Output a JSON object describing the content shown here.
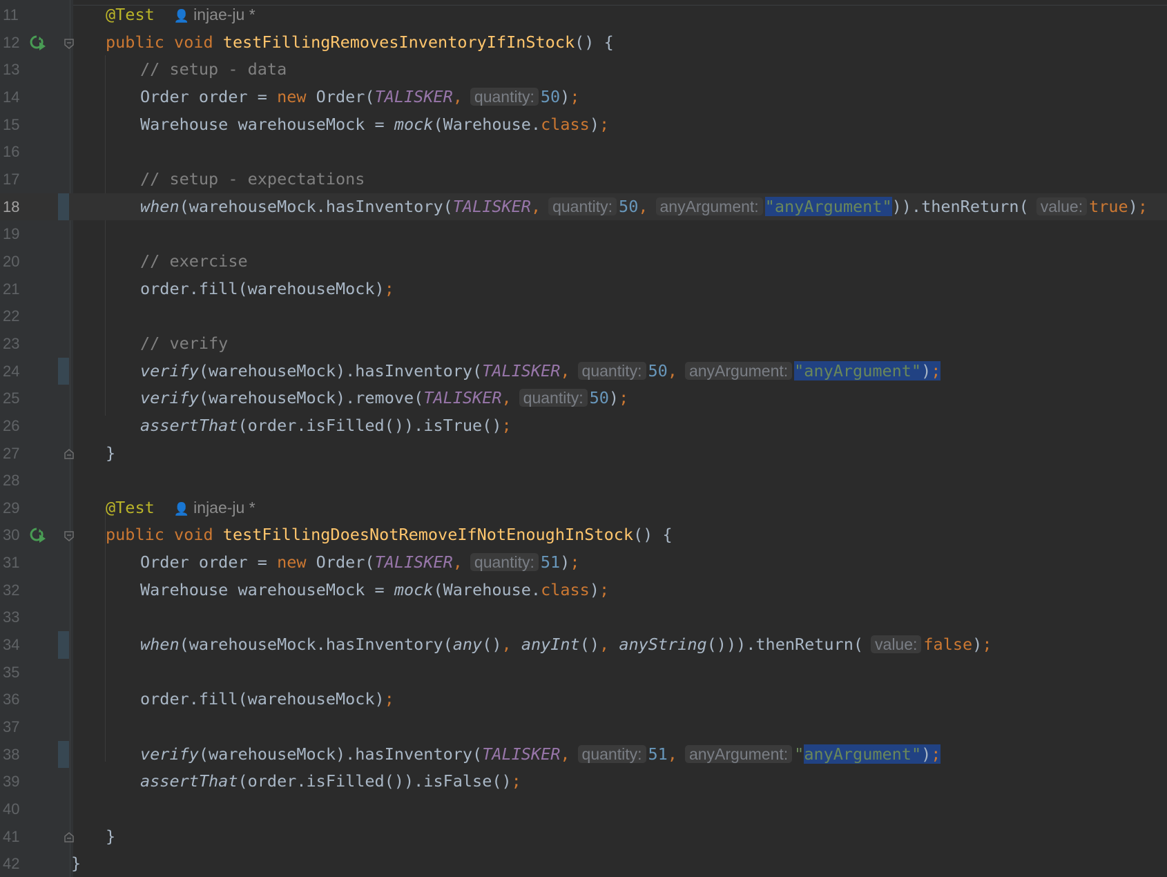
{
  "editor": {
    "lines": {
      "l11": {
        "num": "11",
        "annotation": "@Test",
        "author": "injae-ju *"
      },
      "l12": {
        "num": "12",
        "kw1": "public",
        "kw2": "void",
        "method": "testFillingRemovesInventoryIfInStock",
        "rest": "() {"
      },
      "l13": {
        "num": "13",
        "comment": "// setup - data"
      },
      "l14": {
        "num": "14",
        "t1": "Order order = ",
        "kw": "new",
        "t2": " Order(",
        "c1": "TALISKER",
        "comma": ",",
        "h_quantity": "quantity:",
        "n1": "50",
        "close": ")",
        "semi": ";"
      },
      "l15": {
        "num": "15",
        "t1": "Warehouse warehouseMock = ",
        "it": "mock",
        "t2": "(Warehouse.",
        "kw": "class",
        "t3": ")",
        "semi": ";"
      },
      "l16": {
        "num": "16"
      },
      "l17": {
        "num": "17",
        "comment": "// setup - expectations"
      },
      "l18": {
        "num": "18",
        "it": "when",
        "t1": "(warehouseMock.hasInventory(",
        "c1": "TALISKER",
        "comma1": ",",
        "h_quantity": "quantity:",
        "n1": "50",
        "comma2": ",",
        "h_any": "anyArgument:",
        "s1": "\"anyArgument\"",
        "t2": ")).thenReturn(",
        "h_value": "value:",
        "kw": "true",
        "t3": ")",
        "semi": ";"
      },
      "l19": {
        "num": "19"
      },
      "l20": {
        "num": "20",
        "comment": "// exercise"
      },
      "l21": {
        "num": "21",
        "t1": "order.fill(warehouseMock)",
        "semi": ";"
      },
      "l22": {
        "num": "22"
      },
      "l23": {
        "num": "23",
        "comment": "// verify"
      },
      "l24": {
        "num": "24",
        "it": "verify",
        "t1": "(warehouseMock).hasInventory(",
        "c1": "TALISKER",
        "comma1": ",",
        "h_quantity": "quantity:",
        "n1": "50",
        "comma2": ",",
        "h_any": "anyArgument:",
        "s1": "\"anyArgument\"",
        "t2": ")",
        "semi": ";"
      },
      "l25": {
        "num": "25",
        "it": "verify",
        "t1": "(warehouseMock).remove(",
        "c1": "TALISKER",
        "comma1": ",",
        "h_quantity": "quantity:",
        "n1": "50",
        "t2": ")",
        "semi": ";"
      },
      "l26": {
        "num": "26",
        "it": "assertThat",
        "t1": "(order.isFilled()).isTrue()",
        "semi": ";"
      },
      "l27": {
        "num": "27",
        "t1": "}"
      },
      "l28": {
        "num": "28"
      },
      "l29": {
        "num": "29",
        "annotation": "@Test",
        "author": "injae-ju *"
      },
      "l30": {
        "num": "30",
        "kw1": "public",
        "kw2": "void",
        "method": "testFillingDoesNotRemoveIfNotEnoughInStock",
        "rest": "() {"
      },
      "l31": {
        "num": "31",
        "t1": "Order order = ",
        "kw": "new",
        "t2": " Order(",
        "c1": "TALISKER",
        "comma": ",",
        "h_quantity": "quantity:",
        "n1": "51",
        "close": ")",
        "semi": ";"
      },
      "l32": {
        "num": "32",
        "t1": "Warehouse warehouseMock = ",
        "it": "mock",
        "t2": "(Warehouse.",
        "kw": "class",
        "t3": ")",
        "semi": ";"
      },
      "l33": {
        "num": "33"
      },
      "l34": {
        "num": "34",
        "it": "when",
        "t1": "(warehouseMock.hasInventory(",
        "i2": "any",
        "t2": "()",
        "comma1": ",",
        "i3": "anyInt",
        "t3": "()",
        "comma2": ",",
        "i4": "anyString",
        "t4": "())).thenReturn(",
        "h_value": "value:",
        "kw": "false",
        "t5": ")",
        "semi": ";"
      },
      "l35": {
        "num": "35"
      },
      "l36": {
        "num": "36",
        "t1": "order.fill(warehouseMock)",
        "semi": ";"
      },
      "l37": {
        "num": "37"
      },
      "l38": {
        "num": "38",
        "it": "verify",
        "t1": "(warehouseMock).hasInventory(",
        "c1": "TALISKER",
        "comma1": ",",
        "h_quantity": "quantity:",
        "n1": "51",
        "comma2": ",",
        "h_any": "anyArgument:",
        "q": "\"",
        "s1": "anyArgument\"",
        "t2": ")",
        "semi": ";"
      },
      "l39": {
        "num": "39",
        "it": "assertThat",
        "t1": "(order.isFilled()).isFalse()",
        "semi": ";"
      },
      "l40": {
        "num": "40"
      },
      "l41": {
        "num": "41",
        "t1": "}"
      },
      "l42": {
        "num": "42",
        "t1": "}"
      }
    },
    "gutter_icons": {
      "run_test": "run-test-icon",
      "fold": "fold-icon"
    },
    "colors": {
      "background": "#2b2b2b",
      "keyword": "#cc7832",
      "annotation": "#bbb529",
      "method": "#ffc66d",
      "comment": "#808080",
      "number": "#6897bb",
      "string": "#6a8759",
      "constant": "#9876aa",
      "selection": "#214283"
    }
  }
}
